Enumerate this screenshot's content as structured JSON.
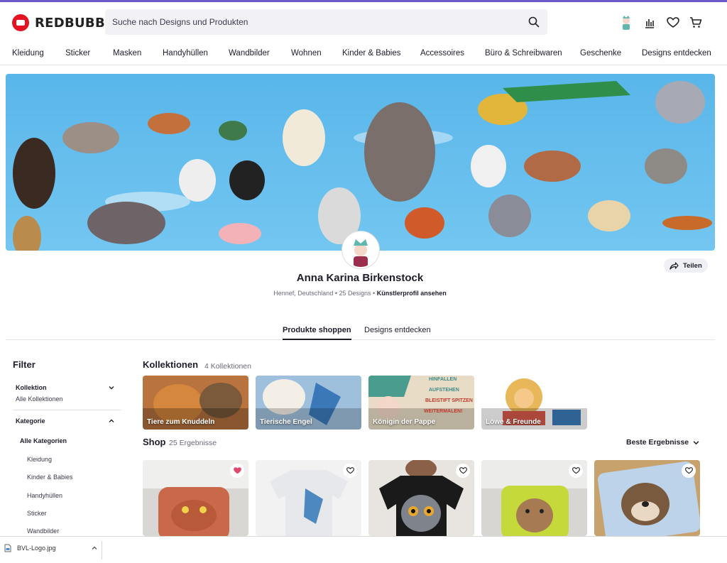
{
  "brand": {
    "name": "REDBUBBLE",
    "color": "#e41321"
  },
  "search": {
    "placeholder": "Suche nach Designs und Produkten"
  },
  "nav": [
    "Kleidung",
    "Sticker",
    "Masken",
    "Handyhüllen",
    "Wandbilder",
    "Wohnen",
    "Kinder & Babies",
    "Accessoires",
    "Büro & Schreibwaren",
    "Geschenke",
    "Designs entdecken"
  ],
  "header_icons": [
    "avatar-icon",
    "dashboard-icon",
    "heart-icon",
    "cart-icon"
  ],
  "artist": {
    "name": "Anna Karina Birkenstock",
    "location": "Hennef, Deutschland",
    "designs": "25 Designs",
    "profile_link": "Künstlerprofil ansehen",
    "share_label": "Teilen"
  },
  "tabs": [
    {
      "label": "Produkte shoppen",
      "active": true
    },
    {
      "label": "Designs entdecken",
      "active": false
    }
  ],
  "filter": {
    "title": "Filter",
    "kollektion_label": "Kollektion",
    "kollektion_value": "Alle Kollektionen",
    "kategorie_label": "Kategorie",
    "kategorie_all": "Alle Kategorien",
    "kategorie_items": [
      "Kleidung",
      "Kinder & Babies",
      "Handyhüllen",
      "Sticker",
      "Wandbilder"
    ]
  },
  "collections": {
    "title": "Kollektionen",
    "count": "4 Kollektionen",
    "items": [
      {
        "label": "Tiere zum Knuddeln",
        "color": "#b8733f"
      },
      {
        "label": "Tierische Engel",
        "color": "#9fc0dc"
      },
      {
        "label": "Königin der Pappe",
        "color": "#e9dcc6",
        "art_text": [
          "HINFALLEN",
          "AUFSTEHEN",
          "BLEISTIFT SPITZEN",
          "WEITERMALEN!"
        ]
      },
      {
        "label": "Löwe & Freunde",
        "color": "#e7b75a"
      }
    ]
  },
  "shop": {
    "title": "Shop",
    "count": "25 Ergebnisse",
    "sort_label": "Beste Ergebnisse"
  },
  "products": [
    {
      "name": "crab-pillow",
      "favorited": true,
      "color": "#c9694a"
    },
    {
      "name": "dragon-tshirt",
      "favorited": false,
      "color": "#e6e8ec"
    },
    {
      "name": "owl-tshirt",
      "favorited": false,
      "color": "#8a6048"
    },
    {
      "name": "quokka-pillow",
      "favorited": false,
      "color": "#c5d93a"
    },
    {
      "name": "otter-pillow",
      "favorited": false,
      "color": "#bcd3ea"
    }
  ],
  "download": {
    "filename": "BVL-Logo.jpg"
  }
}
